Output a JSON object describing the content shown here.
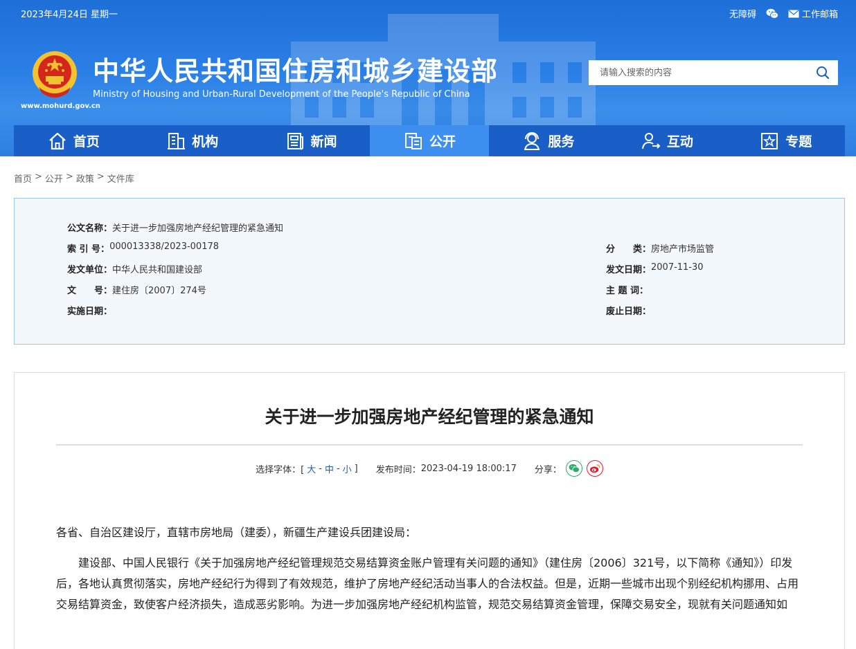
{
  "topbar": {
    "date": "2023年4月24日 星期一",
    "accessibility": "无障碍",
    "wechat_icon": "wechat-icon",
    "mail_label": "工作邮箱"
  },
  "brand": {
    "url": "www.mohurd.gov.cn",
    "title": "中华人民共和国住房和城乡建设部",
    "subtitle": "Ministry of Housing and Urban-Rural Development of the People's Republic of China",
    "emblem_icon": "national-emblem-icon"
  },
  "search": {
    "placeholder": "请输入搜索的内容",
    "icon": "search-icon"
  },
  "nav": {
    "items": [
      {
        "label": "首页",
        "icon": "home-icon"
      },
      {
        "label": "机构",
        "icon": "building-icon"
      },
      {
        "label": "新闻",
        "icon": "news-icon"
      },
      {
        "label": "公开",
        "icon": "document-icon",
        "active": true
      },
      {
        "label": "服务",
        "icon": "service-icon"
      },
      {
        "label": "互动",
        "icon": "interaction-icon"
      },
      {
        "label": "专题",
        "icon": "topic-icon"
      }
    ]
  },
  "breadcrumb": {
    "items": [
      "首页",
      "公开",
      "政策",
      "文件库"
    ],
    "separator": ">"
  },
  "meta": {
    "name_label": "公文名称：",
    "name_value": "关于进一步加强房地产经纪管理的紧急通知",
    "index_label": "索 引 号：",
    "index_value": "000013338/2023-00178",
    "category_label": "分　　类：",
    "category_value": "房地产市场监管",
    "issuer_label": "发文单位：",
    "issuer_value": "中华人民共和国建设部",
    "issue_date_label": "发文日期：",
    "issue_date_value": "2007-11-30",
    "docno_label": "文　　号：",
    "docno_value": "建住房〔2007〕274号",
    "keywords_label": "主 题 词：",
    "keywords_value": "",
    "effective_label": "实施日期：",
    "effective_value": "",
    "expiry_label": "废止日期：",
    "expiry_value": ""
  },
  "article": {
    "title": "关于进一步加强房地产经纪管理的紧急通知",
    "font_label": "选择字体：[",
    "font_large": "大",
    "font_medium": "中",
    "font_small": "小",
    "font_end": "]",
    "font_sep": "-",
    "publish_label": "发布时间：",
    "publish_time": "2023-04-19 18:00:17",
    "share_label": "分享：",
    "share_wechat_color": "#2aae67",
    "share_weibo_color": "#e6162d",
    "salutation": "各省、自治区建设厅，直辖市房地局（建委），新疆生产建设兵团建设局：",
    "paragraph1": "建设部、中国人民银行《关于加强房地产经纪管理规范交易结算资金账户管理有关问题的通知》（建住房〔2006〕321号，以下简称《通知》）印发后，各地认真贯彻落实，房地产经纪行为得到了有效规范，维护了房地产经纪活动当事人的合法权益。但是，近期一些城市出现个别经纪机构挪用、占用交易结算资金，致使客户经济损失，造成恶劣影响。为进一步加强房地产经纪机构监管，规范交易结算资金管理，保障交易安全，现就有关问题通知如"
  },
  "colors": {
    "header_blue": "#2a7fe6",
    "nav_blue": "#1a5fc7",
    "nav_active": "#3d8ff0",
    "meta_bg": "#f3f8fd",
    "meta_border": "#9dc3ea"
  }
}
